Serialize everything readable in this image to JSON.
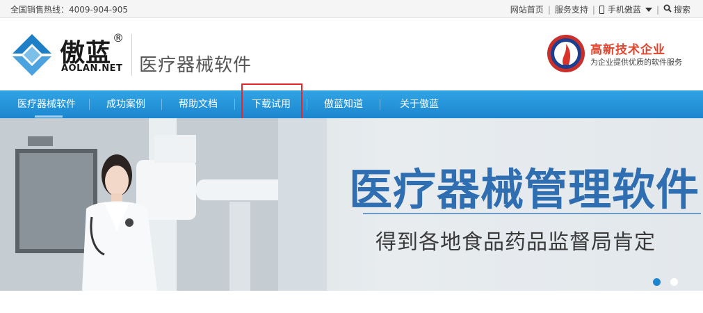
{
  "topbar": {
    "hotline": "全国销售热线：4009-904-905",
    "links": [
      "网站首页",
      "服务支持",
      "手机傲蓝",
      "搜索"
    ]
  },
  "header": {
    "brand_cn": "傲蓝",
    "brand_reg": "®",
    "brand_en": "AOLAN.NET",
    "brand_sub": "医疗器械软件",
    "badge_title": "高新技术企业",
    "badge_sub": "为企业提供优质的软件服务"
  },
  "nav": {
    "items": [
      "医疗器械软件",
      "成功案例",
      "帮助文档",
      "下载试用",
      "傲蓝知道",
      "关于傲蓝"
    ],
    "highlighted": "下载试用"
  },
  "banner": {
    "title": "医疗器械管理软件",
    "subtitle": "得到各地食品药品监督局肯定",
    "slides": 2,
    "active_slide": 1
  },
  "colors": {
    "nav_blue": "#1b86cf",
    "banner_title": "#2f6eb0",
    "badge_red": "#e0452e",
    "highlight_red": "#e8262b"
  }
}
